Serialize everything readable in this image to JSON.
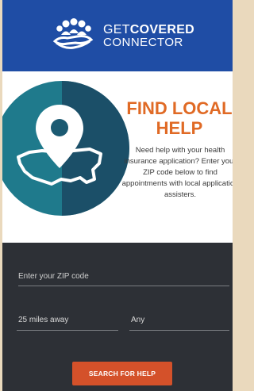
{
  "header": {
    "logo_line1_light": "GET",
    "logo_line1_bold": "COVERED",
    "logo_line2": "CONNECTOR",
    "brand_color": "#1f4da5"
  },
  "hero": {
    "title": "FIND LOCAL HELP",
    "body": "Need help with your health insurance application? Enter your ZIP code below to find appointments with local application assisters.",
    "icon": "map-pin-usa-icon",
    "accent_color": "#e06a25"
  },
  "form": {
    "zip_placeholder": "Enter your ZIP code",
    "distance_value": "25 miles away",
    "type_value": "Any",
    "search_label": "SEARCH FOR HELP",
    "button_color": "#d4512a"
  }
}
